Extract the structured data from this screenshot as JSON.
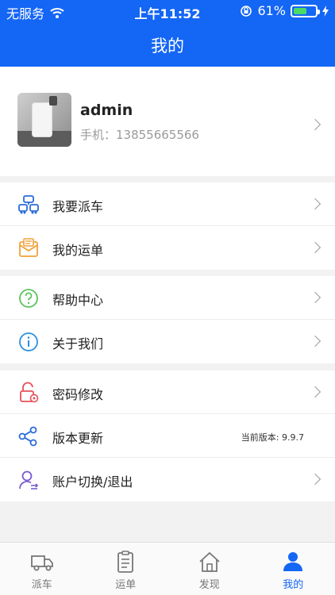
{
  "status_bar": {
    "carrier": "无服务",
    "time": "上午11:52",
    "battery": "61%",
    "battery_level": 0.61
  },
  "header": {
    "title": "我的"
  },
  "profile": {
    "name": "admin",
    "phone": "手机：13855665566"
  },
  "menu": {
    "group1": [
      {
        "label": "我要派车",
        "icon": "dispatch-icon"
      },
      {
        "label": "我的运单",
        "icon": "waybill-icon"
      }
    ],
    "group2": [
      {
        "label": "帮助中心",
        "icon": "help-icon"
      },
      {
        "label": "关于我们",
        "icon": "info-icon"
      }
    ],
    "group3": [
      {
        "label": "密码修改",
        "icon": "lock-icon"
      },
      {
        "label": "版本更新",
        "icon": "share-icon",
        "version": "当前版本: 9.9.7"
      },
      {
        "label": "账户切换/退出",
        "icon": "user-switch-icon"
      }
    ]
  },
  "tabs": [
    {
      "label": "派车",
      "icon": "truck-icon"
    },
    {
      "label": "运单",
      "icon": "clipboard-icon"
    },
    {
      "label": "发现",
      "icon": "home-icon"
    },
    {
      "label": "我的",
      "icon": "person-icon",
      "active": true
    }
  ],
  "colors": {
    "primary": "#1466f5",
    "battery": "#4cd964"
  }
}
